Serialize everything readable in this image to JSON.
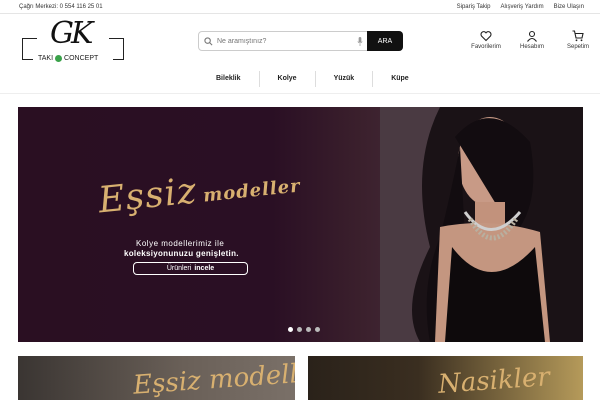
{
  "topbar": {
    "phone": "Çağrı Merkezi: 0 554 116 25 01",
    "links": [
      "Sipariş Takip",
      "Alışveriş Yardım",
      "Bize Ulaşın"
    ]
  },
  "logo": {
    "monogram": "GK",
    "wordmark_left": "TAKI",
    "wordmark_right": "CONCEPT"
  },
  "search": {
    "placeholder": "Ne aramıştınız?",
    "button_label": "ARA"
  },
  "header_icons": [
    {
      "label": "Favorilerim",
      "icon": "heart-icon"
    },
    {
      "label": "Hesabım",
      "icon": "user-icon"
    },
    {
      "label": "Sepetim",
      "icon": "cart-icon"
    }
  ],
  "nav": [
    "Bileklik",
    "Kolye",
    "Yüzük",
    "Küpe"
  ],
  "hero": {
    "script_title": "Eşsiz",
    "script_title_2": "modeller",
    "line1": "Kolye modellerimiz ile",
    "line2": "koleksiyonunuzu genişletin.",
    "cta_prefix": "Ürünleri",
    "cta_bold": "incele",
    "slides": 4,
    "active_slide": 1
  },
  "banners": [
    {
      "script": "Eşsiz modeller"
    },
    {
      "script": "Nasikler"
    }
  ],
  "colors": {
    "accent_gold": "#d8b070",
    "hero_bg": "#2a0f22",
    "button_dark": "#111111"
  }
}
